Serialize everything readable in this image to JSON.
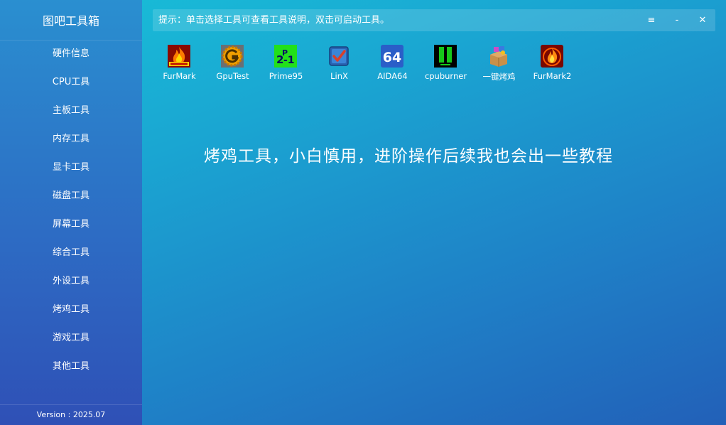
{
  "app": {
    "title": "图吧工具箱",
    "version": "Version : 2025.07"
  },
  "sidebar": {
    "items": [
      {
        "label": "硬件信息"
      },
      {
        "label": "CPU工具"
      },
      {
        "label": "主板工具"
      },
      {
        "label": "内存工具"
      },
      {
        "label": "显卡工具"
      },
      {
        "label": "磁盘工具"
      },
      {
        "label": "屏幕工具"
      },
      {
        "label": "综合工具"
      },
      {
        "label": "外设工具"
      },
      {
        "label": "烤鸡工具"
      },
      {
        "label": "游戏工具"
      },
      {
        "label": "其他工具"
      }
    ]
  },
  "tipbar": {
    "text": "提示：单击选择工具可查看工具说明，双击可启动工具。",
    "menu_glyph": "≡",
    "minimize_glyph": "-",
    "close_glyph": "✕"
  },
  "tools": [
    {
      "label": "FurMark",
      "icon": "furmark-icon"
    },
    {
      "label": "GpuTest",
      "icon": "gputest-icon"
    },
    {
      "label": "Prime95",
      "icon": "prime95-icon"
    },
    {
      "label": "LinX",
      "icon": "linx-icon"
    },
    {
      "label": "AIDA64",
      "icon": "aida64-icon"
    },
    {
      "label": "cpuburner",
      "icon": "cpuburner-icon"
    },
    {
      "label": "一键烤鸡",
      "icon": "one-click-burn-icon"
    },
    {
      "label": "FurMark2",
      "icon": "furmark2-icon"
    }
  ],
  "main": {
    "headline": "烤鸡工具，小白慎用，进阶操作后续我也会出一些教程"
  },
  "colors": {
    "accent": "#18c0d8",
    "sidebar": "#2d6cc4"
  }
}
